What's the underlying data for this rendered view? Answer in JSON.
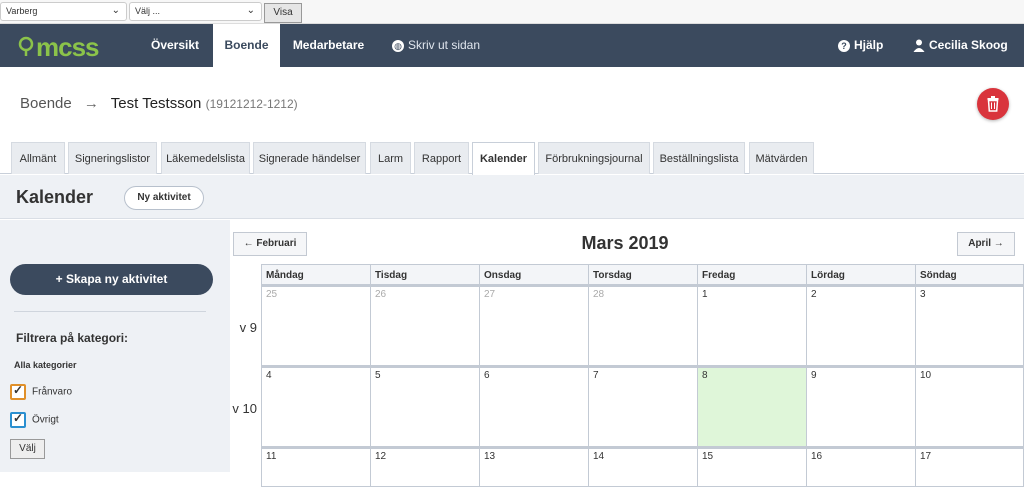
{
  "topbar": {
    "location_select": "Varberg",
    "second_select": "Välj ...",
    "visa_label": "Visa"
  },
  "nav": {
    "logo": "mcss",
    "items": [
      "Översikt",
      "Boende",
      "Medarbetare"
    ],
    "active": "Boende",
    "print_label": "Skriv ut sidan",
    "help_label": "Hjälp",
    "user_label": "Cecilia Skoog"
  },
  "breadcrumb": {
    "root": "Boende",
    "arrow": "→",
    "person": "Test Testsson",
    "pnr": "(19121212-1212)"
  },
  "tabs": [
    "Allmänt",
    "Signeringslistor",
    "Läkemedelslista",
    "Signerade händelser",
    "Larm",
    "Rapport",
    "Kalender",
    "Förbrukningsjournal",
    "Beställningslista",
    "Mätvärden"
  ],
  "active_tab": "Kalender",
  "calendar_header": {
    "title": "Kalender",
    "new_activity": "Ny aktivitet"
  },
  "sidebar": {
    "create_button": "+ Skapa ny aktivitet",
    "filter_title": "Filtrera på kategori:",
    "all_categories": "Alla kategorier",
    "categories": [
      {
        "label": "Frånvaro",
        "checked": true,
        "color": "#e0902a"
      },
      {
        "label": "Övrigt",
        "checked": true,
        "color": "#2a8fd0"
      }
    ],
    "select_button": "Välj"
  },
  "calendar": {
    "prev_label": "← Februari",
    "next_label": "April →",
    "month_title": "Mars 2019",
    "weekdays": [
      "Måndag",
      "Tisdag",
      "Onsdag",
      "Torsdag",
      "Fredag",
      "Lördag",
      "Söndag"
    ],
    "weeks": [
      {
        "label": "v 9",
        "days": [
          "25",
          "26",
          "27",
          "28",
          "1",
          "2",
          "3"
        ]
      },
      {
        "label": "v 10",
        "days": [
          "4",
          "5",
          "6",
          "7",
          "8",
          "9",
          "10"
        ]
      },
      {
        "label": "",
        "days": [
          "11",
          "12",
          "13",
          "14",
          "15",
          "16",
          "17"
        ]
      }
    ],
    "today": "8",
    "today_color": "#dff6d9"
  }
}
